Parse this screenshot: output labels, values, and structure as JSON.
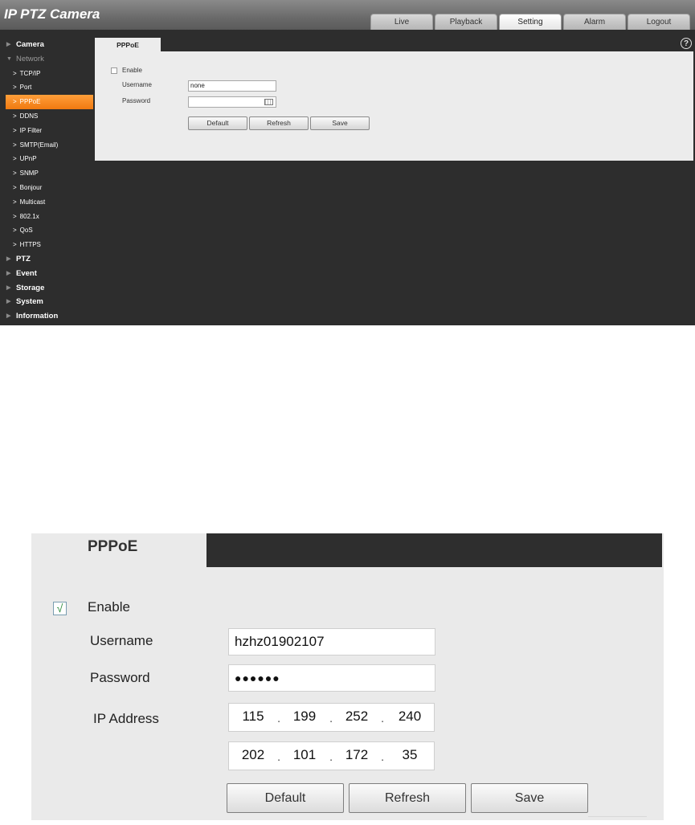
{
  "app": {
    "title": "IP PTZ Camera"
  },
  "nav_tabs": [
    {
      "label": "Live"
    },
    {
      "label": "Playback"
    },
    {
      "label": "Setting",
      "active": true
    },
    {
      "label": "Alarm"
    },
    {
      "label": "Logout"
    }
  ],
  "sidebar": {
    "items": [
      {
        "label": "Camera"
      },
      {
        "label": "Network"
      },
      {
        "label": "TCP/IP"
      },
      {
        "label": "Port"
      },
      {
        "label": "PPPoE"
      },
      {
        "label": "DDNS"
      },
      {
        "label": "IP Filter"
      },
      {
        "label": "SMTP(Email)"
      },
      {
        "label": "UPnP"
      },
      {
        "label": "SNMP"
      },
      {
        "label": "Bonjour"
      },
      {
        "label": "Multicast"
      },
      {
        "label": "802.1x"
      },
      {
        "label": "QoS"
      },
      {
        "label": "HTTPS"
      },
      {
        "label": "PTZ"
      },
      {
        "label": "Event"
      },
      {
        "label": "Storage"
      },
      {
        "label": "System"
      },
      {
        "label": "Information"
      }
    ],
    "active_item": "PPPoE",
    "accent_color": "#f58a1f"
  },
  "panel": {
    "tab": "PPPoE",
    "help_icon": "question-circle-icon",
    "enable_label": "Enable",
    "enable_checked": false,
    "username_label": "Username",
    "username_value": "none",
    "password_label": "Password",
    "password_value": "",
    "keyboard_icon": "keyboard-icon",
    "buttons": {
      "default": "Default",
      "refresh": "Refresh",
      "save": "Save"
    }
  },
  "zoom": {
    "tab": "PPPoE",
    "enable_label": "Enable",
    "enable_checked": true,
    "check_mark": "√",
    "username_label": "Username",
    "username_value": "hzhz01902107",
    "password_label": "Password",
    "password_mask": "●●●●●●",
    "ip_label": "IP Address",
    "ip1": [
      "115",
      "199",
      "252",
      "240"
    ],
    "ip2": [
      "202",
      "101",
      "172",
      "35"
    ],
    "ip_separator": ".",
    "buttons": {
      "default": "Default",
      "refresh": "Refresh",
      "save": "Save"
    }
  }
}
